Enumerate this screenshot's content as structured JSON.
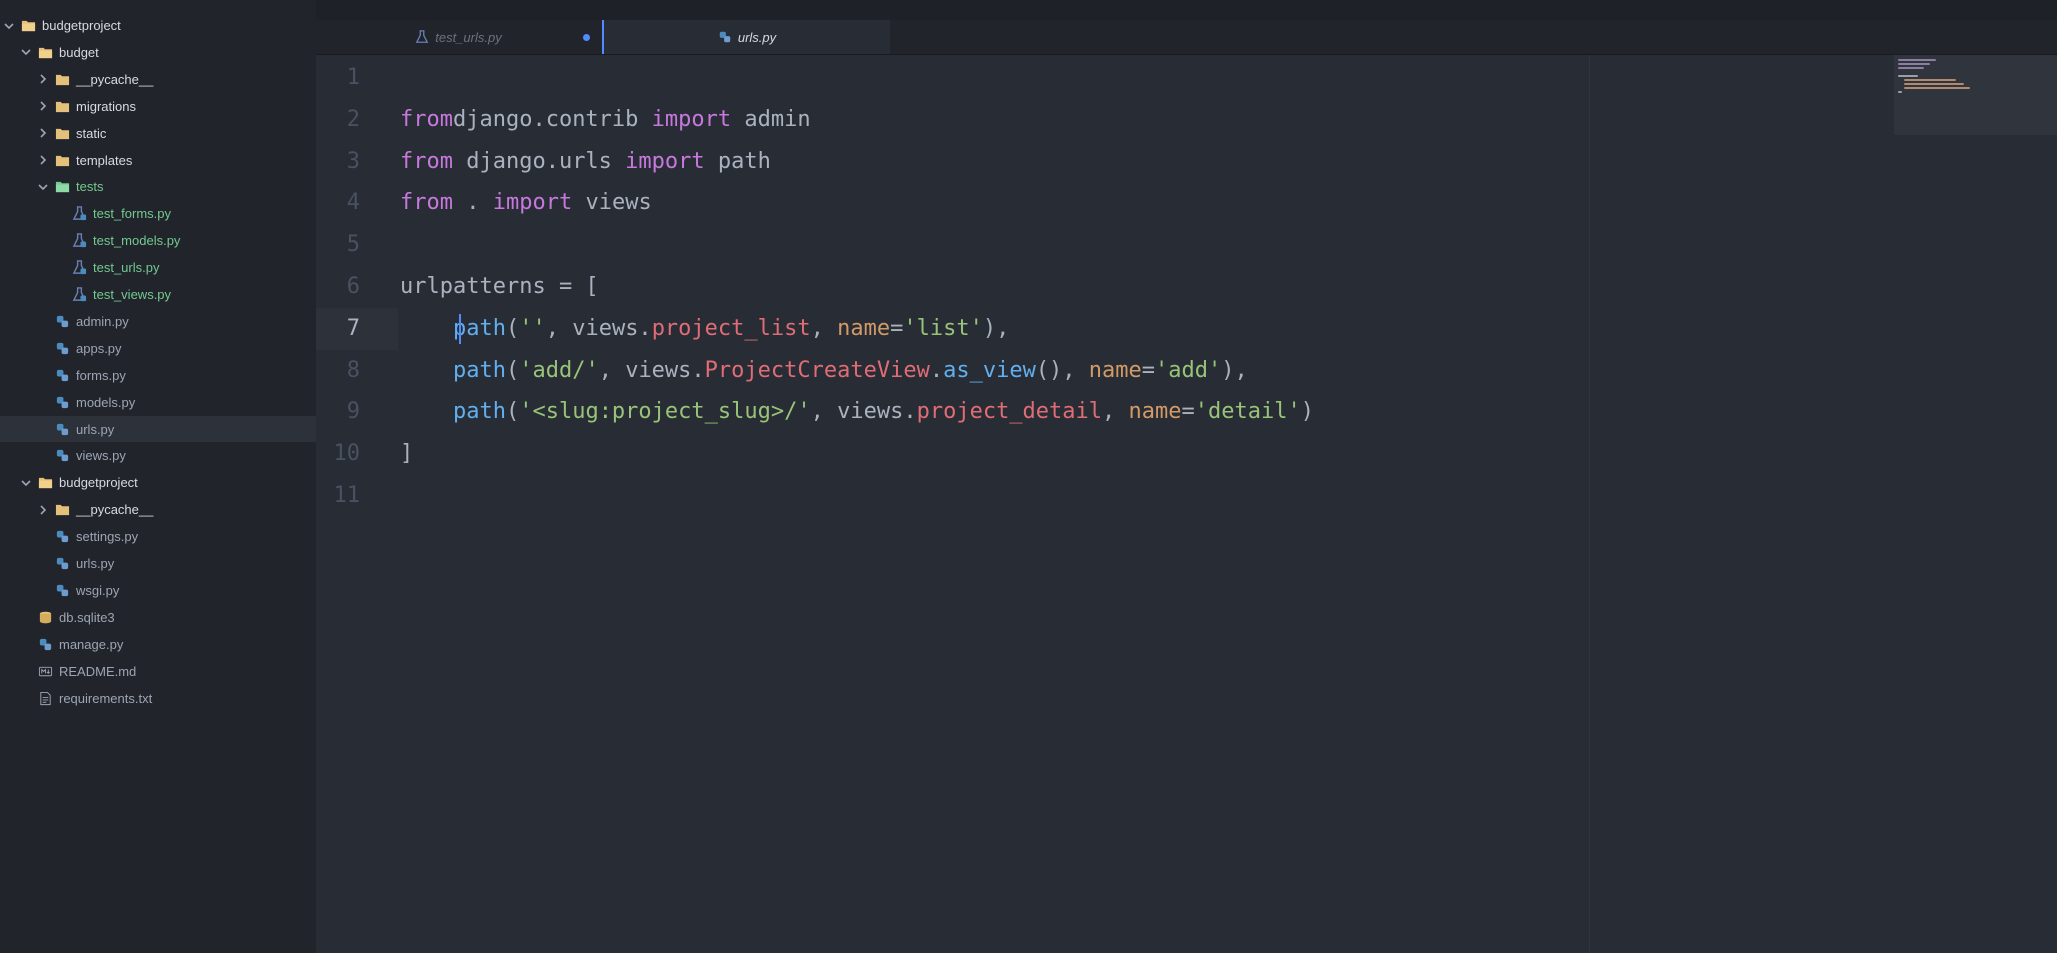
{
  "tree": [
    {
      "label": "budgetproject",
      "type": "dir",
      "open": true,
      "depth": 0,
      "name": "tree-root-budgetproject"
    },
    {
      "label": "budget",
      "type": "dir",
      "open": true,
      "depth": 1,
      "name": "tree-dir-budget"
    },
    {
      "label": "__pycache__",
      "type": "dir",
      "open": false,
      "depth": 2,
      "name": "tree-dir-budget-pycache"
    },
    {
      "label": "migrations",
      "type": "dir",
      "open": false,
      "depth": 2,
      "name": "tree-dir-migrations"
    },
    {
      "label": "static",
      "type": "dir",
      "open": false,
      "depth": 2,
      "name": "tree-dir-static"
    },
    {
      "label": "templates",
      "type": "dir",
      "open": false,
      "depth": 2,
      "name": "tree-dir-templates"
    },
    {
      "label": "tests",
      "type": "dir",
      "open": true,
      "depth": 2,
      "git": "new",
      "name": "tree-dir-tests"
    },
    {
      "label": "test_forms.py",
      "type": "test",
      "depth": 3,
      "git": "new",
      "name": "tree-file-test-forms"
    },
    {
      "label": "test_models.py",
      "type": "test",
      "depth": 3,
      "git": "new",
      "name": "tree-file-test-models"
    },
    {
      "label": "test_urls.py",
      "type": "test",
      "depth": 3,
      "git": "new",
      "name": "tree-file-test-urls"
    },
    {
      "label": "test_views.py",
      "type": "test",
      "depth": 3,
      "git": "new",
      "name": "tree-file-test-views"
    },
    {
      "label": "admin.py",
      "type": "py",
      "depth": 2,
      "name": "tree-file-admin"
    },
    {
      "label": "apps.py",
      "type": "py",
      "depth": 2,
      "name": "tree-file-apps"
    },
    {
      "label": "forms.py",
      "type": "py",
      "depth": 2,
      "name": "tree-file-forms"
    },
    {
      "label": "models.py",
      "type": "py",
      "depth": 2,
      "name": "tree-file-models"
    },
    {
      "label": "urls.py",
      "type": "py",
      "depth": 2,
      "selected": true,
      "name": "tree-file-budget-urls"
    },
    {
      "label": "views.py",
      "type": "py",
      "depth": 2,
      "name": "tree-file-views"
    },
    {
      "label": "budgetproject",
      "type": "dir",
      "open": true,
      "depth": 1,
      "name": "tree-dir-budgetproject"
    },
    {
      "label": "__pycache__",
      "type": "dir",
      "open": false,
      "depth": 2,
      "name": "tree-dir-project-pycache"
    },
    {
      "label": "settings.py",
      "type": "py",
      "depth": 2,
      "name": "tree-file-settings"
    },
    {
      "label": "urls.py",
      "type": "py",
      "depth": 2,
      "name": "tree-file-project-urls"
    },
    {
      "label": "wsgi.py",
      "type": "py",
      "depth": 2,
      "name": "tree-file-wsgi"
    },
    {
      "label": "db.sqlite3",
      "type": "db",
      "depth": 1,
      "name": "tree-file-db"
    },
    {
      "label": "manage.py",
      "type": "py",
      "depth": 1,
      "name": "tree-file-manage"
    },
    {
      "label": "README.md",
      "type": "md",
      "depth": 1,
      "name": "tree-file-readme"
    },
    {
      "label": "requirements.txt",
      "type": "txt",
      "depth": 1,
      "name": "tree-file-requirements"
    }
  ],
  "tabs": [
    {
      "label": "test_urls.py",
      "active": false,
      "modified": true,
      "icon": "test-file-icon"
    },
    {
      "label": "urls.py",
      "active": true,
      "modified": false,
      "icon": "python-icon"
    }
  ],
  "editor": {
    "active_line": 7,
    "lines": [
      {
        "n": "1",
        "tokens": []
      },
      {
        "n": "2",
        "tokens": [
          [
            "kw",
            "from"
          ],
          [
            "",
            "django.contrib "
          ],
          [
            "kw",
            "import"
          ],
          [
            "",
            " admin"
          ]
        ]
      },
      {
        "n": "3",
        "tokens": [
          [
            "kw",
            "from"
          ],
          [
            "",
            " django.urls "
          ],
          [
            "kw",
            "import"
          ],
          [
            "",
            " path"
          ]
        ]
      },
      {
        "n": "4",
        "tokens": [
          [
            "kw",
            "from"
          ],
          [
            "",
            " . "
          ],
          [
            "kw",
            "import"
          ],
          [
            "",
            " views"
          ]
        ]
      },
      {
        "n": "5",
        "tokens": []
      },
      {
        "n": "6",
        "tokens": [
          [
            "",
            "urlpatterns = ["
          ]
        ]
      },
      {
        "n": "7",
        "tokens": [
          [
            "",
            "    "
          ],
          [
            "fn",
            "path"
          ],
          [
            "",
            "("
          ],
          [
            "str",
            "''"
          ],
          [
            "",
            ", views."
          ],
          [
            "prop",
            "project_list"
          ],
          [
            "",
            ", "
          ],
          [
            "attr",
            "name"
          ],
          [
            "",
            "="
          ],
          [
            "str",
            "'list'"
          ],
          [
            "",
            "),"
          ]
        ]
      },
      {
        "n": "8",
        "tokens": [
          [
            "",
            "    "
          ],
          [
            "fn",
            "path"
          ],
          [
            "",
            "("
          ],
          [
            "str",
            "'add/'"
          ],
          [
            "",
            ", views."
          ],
          [
            "prop",
            "ProjectCreateView"
          ],
          [
            "",
            "."
          ],
          [
            "fn",
            "as_view"
          ],
          [
            "",
            "(), "
          ],
          [
            "attr",
            "name"
          ],
          [
            "",
            "="
          ],
          [
            "str",
            "'add'"
          ],
          [
            "",
            "),"
          ]
        ]
      },
      {
        "n": "9",
        "tokens": [
          [
            "",
            "    "
          ],
          [
            "fn",
            "path"
          ],
          [
            "",
            "("
          ],
          [
            "str",
            "'<slug:project_slug>/'"
          ],
          [
            "",
            ", views."
          ],
          [
            "prop",
            "project_detail"
          ],
          [
            "",
            ", "
          ],
          [
            "attr",
            "name"
          ],
          [
            "",
            "="
          ],
          [
            "str",
            "'detail'"
          ],
          [
            "",
            ")"
          ]
        ]
      },
      {
        "n": "10",
        "tokens": [
          [
            "",
            "]"
          ]
        ]
      },
      {
        "n": "11",
        "tokens": []
      }
    ]
  },
  "colors": {
    "keyword": "#c678dd",
    "function": "#61afef",
    "string": "#98c379",
    "property": "#e06c75",
    "attribute": "#d19a66",
    "git_new": "#73c990",
    "folder": "#e5c07b",
    "accent": "#528bff"
  }
}
